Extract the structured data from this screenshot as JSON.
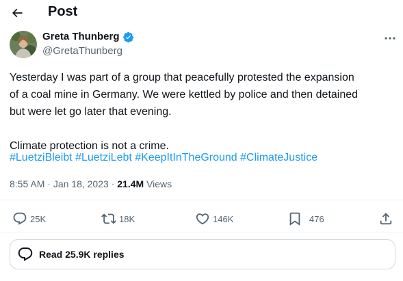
{
  "header": {
    "title": "Post"
  },
  "author": {
    "name": "Greta Thunberg",
    "handle": "@GretaThunberg",
    "verified": true
  },
  "post": {
    "body": "Yesterday I was part of a group that peacefully protested the expansion\nof a coal mine in Germany. We were kettled by police and then detained\nbut were let go later that evening.\n\nClimate protection is not a crime.",
    "hashtags": [
      "#LuetziBleibt",
      "#LuetziLebt",
      "#KeepItInTheGround",
      "#ClimateJustice"
    ]
  },
  "meta": {
    "time": "8:55 AM",
    "date": "Jan 18, 2023",
    "views_count": "21.4M",
    "views_label": "Views"
  },
  "actions": {
    "replies": "25K",
    "reposts": "18K",
    "likes": "146K",
    "bookmarks": "476"
  },
  "read_replies": {
    "label": "Read 25.9K replies"
  },
  "colors": {
    "link": "#1d9bf0",
    "verified": "#1d9bf0",
    "secondary_text": "#536471",
    "border": "#cfd9de"
  },
  "icons": [
    "back-arrow-icon",
    "verified-badge-icon",
    "more-icon",
    "reply-icon",
    "repost-icon",
    "like-icon",
    "bookmark-icon",
    "share-icon",
    "speech-bubble-icon"
  ]
}
